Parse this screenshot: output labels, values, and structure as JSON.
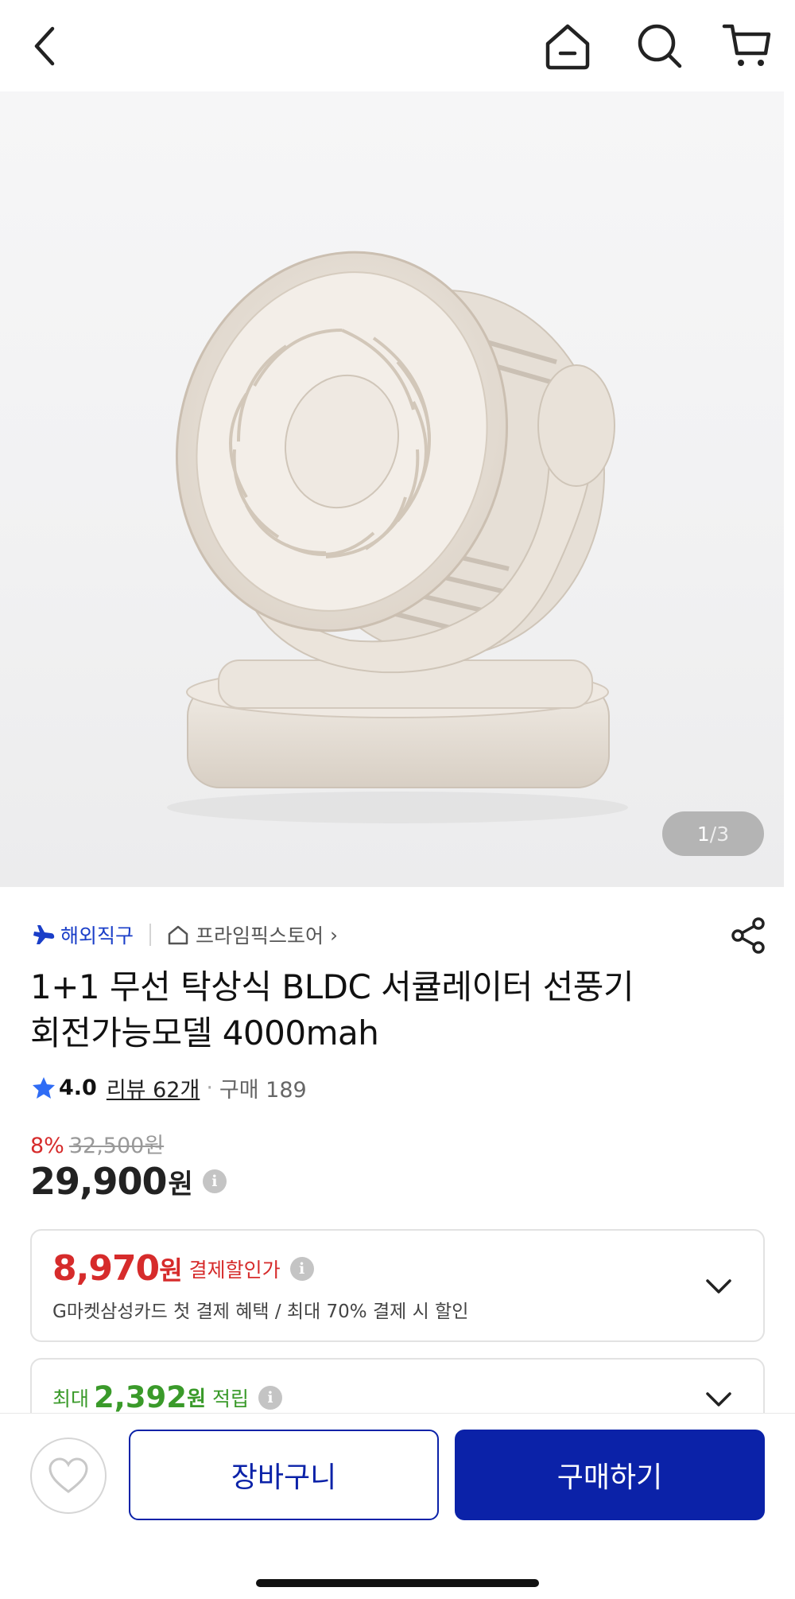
{
  "header": {
    "back_icon": "chevron-left-icon",
    "home_icon": "home-icon",
    "search_icon": "search-icon",
    "cart_icon": "cart-icon"
  },
  "gallery": {
    "current": "1",
    "separator": "/",
    "total": "3"
  },
  "seller": {
    "overseas_label": "해외직구",
    "store_name": "프라임픽스토어",
    "store_chevron": "›"
  },
  "product": {
    "title_line1": "1+1 무선 탁상식 BLDC 서큘레이터 선풍기",
    "title_line2": "회전가능모델 4000mah"
  },
  "rating": {
    "score": "4.0",
    "review_label": "리뷰 62개",
    "dot": "·",
    "purchase_label": "구매 189"
  },
  "pricing": {
    "discount_pct": "8%",
    "original_price": "32,500원",
    "price": "29,900",
    "price_unit": "원",
    "info_glyph": "i"
  },
  "payment_discount": {
    "amount": "8,970",
    "unit": "원",
    "label": "결제할인가",
    "description": "G마켓삼성카드 첫 결제 혜택 / 최대 70% 결제 시 할인"
  },
  "reward": {
    "prefix": "최대",
    "amount": "2,392",
    "unit": "원",
    "label": "적립"
  },
  "actions": {
    "cart_label": "장바구니",
    "buy_label": "구매하기"
  },
  "colors": {
    "accent": "#0b22a8",
    "discount_red": "#d62b2b",
    "reward_green": "#3a9a2a"
  }
}
